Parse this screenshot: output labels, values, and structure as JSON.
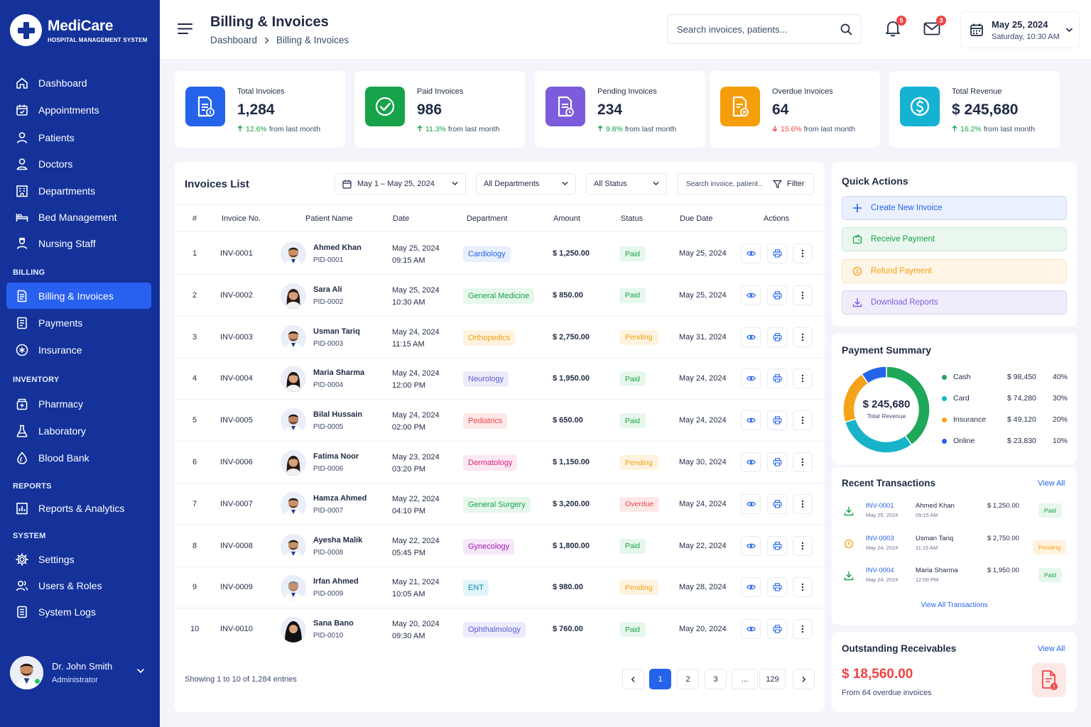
{
  "brand": {
    "name": "MediCare",
    "subtitle": "HOSPITAL MANAGEMENT SYSTEM"
  },
  "sidebar": {
    "main": [
      {
        "label": "Dashboard",
        "icon": "home-icon"
      },
      {
        "label": "Appointments",
        "icon": "calendar-icon"
      },
      {
        "label": "Patients",
        "icon": "user-icon"
      },
      {
        "label": "Doctors",
        "icon": "doctor-icon"
      },
      {
        "label": "Departments",
        "icon": "building-icon"
      },
      {
        "label": "Bed Management",
        "icon": "bed-icon"
      },
      {
        "label": "Nursing Staff",
        "icon": "nurse-icon"
      }
    ],
    "sections": {
      "billing": "BILLING",
      "inventory": "INVENTORY",
      "reports": "REPORTS",
      "system": "SYSTEM"
    },
    "billing": [
      {
        "label": "Billing & Invoices",
        "icon": "invoice-icon"
      },
      {
        "label": "Payments",
        "icon": "payments-icon"
      },
      {
        "label": "Insurance",
        "icon": "insurance-icon"
      }
    ],
    "inventory": [
      {
        "label": "Pharmacy",
        "icon": "pharmacy-icon"
      },
      {
        "label": "Laboratory",
        "icon": "flask-icon"
      },
      {
        "label": "Blood Bank",
        "icon": "blood-drop-icon"
      }
    ],
    "reports": [
      {
        "label": "Reports & Analytics",
        "icon": "analytics-icon"
      }
    ],
    "system": [
      {
        "label": "Settings",
        "icon": "gear-icon"
      },
      {
        "label": "Users & Roles",
        "icon": "users-icon"
      },
      {
        "label": "System Logs",
        "icon": "logs-icon"
      }
    ],
    "user": {
      "name": "Dr. John Smith",
      "role": "Administrator"
    }
  },
  "header": {
    "title": "Billing & Invoices",
    "breadcrumb": [
      "Dashboard",
      "Billing & Invoices"
    ],
    "search_placeholder": "Search invoices, patients...",
    "notifications_count": "5",
    "messages_count": "3",
    "date": "May 25, 2024",
    "day_time": "Saturday, 10:30 AM"
  },
  "stats": [
    {
      "label": "Total Invoices",
      "value": "1,284",
      "change": "12.6%",
      "direction": "up",
      "suffix": "from last month",
      "color": "#2563eb"
    },
    {
      "label": "Paid Invoices",
      "value": "986",
      "change": "11.3%",
      "direction": "up",
      "suffix": "from last month",
      "color": "#16a34a"
    },
    {
      "label": "Pending Invoices",
      "value": "234",
      "change": "9.8%",
      "direction": "up",
      "suffix": "from last month",
      "color": "#7c5cdb"
    },
    {
      "label": "Overdue Invoices",
      "value": "64",
      "change": "15.6%",
      "direction": "down",
      "suffix": "from last month",
      "color": "#f59e0b"
    },
    {
      "label": "Total Revenue",
      "value": "$ 245,680",
      "change": "16.2%",
      "direction": "up",
      "suffix": "from last month",
      "color": "#16b2d4"
    }
  ],
  "invoices": {
    "title": "Invoices List",
    "date_range": "May 1 – May 25, 2024",
    "department_filter": "All Departments",
    "status_filter": "All Status",
    "search_placeholder": "Search invoice, patient...",
    "filter_label": "Filter",
    "columns": [
      "#",
      "Invoice No.",
      "Patient Name",
      "Date",
      "Department",
      "Amount",
      "Status",
      "Due Date",
      "Actions"
    ],
    "rows": [
      {
        "n": "1",
        "inv": "INV-0001",
        "name": "Ahmed Khan",
        "pid": "PID-0001",
        "date": "May 25, 2024",
        "time": "09:15 AM",
        "dept": "Cardiology",
        "dept_color": "#2563eb",
        "dept_bg": "#e8effd",
        "amount": "$ 1,250.00",
        "status": "Paid",
        "due": "May 25, 2024",
        "gender": "m",
        "skin": "#c98e63",
        "hair": "#2a1b12"
      },
      {
        "n": "2",
        "inv": "INV-0002",
        "name": "Sara Ali",
        "pid": "PID-0002",
        "date": "May 25, 2024",
        "time": "10:30 AM",
        "dept": "General Medicine",
        "dept_color": "#15a34a",
        "dept_bg": "#e6f7ec",
        "amount": "$ 850.00",
        "status": "Paid",
        "due": "May 25, 2024",
        "gender": "f",
        "skin": "#d6a07a",
        "hair": "#2a1b12"
      },
      {
        "n": "3",
        "inv": "INV-0003",
        "name": "Usman Tariq",
        "pid": "PID-0003",
        "date": "May 24, 2024",
        "time": "11:15 AM",
        "dept": "Orthopedics",
        "dept_color": "#f59e0b",
        "dept_bg": "#fff3e0",
        "amount": "$ 2,750.00",
        "status": "Pending",
        "due": "May 31, 2024",
        "gender": "m",
        "skin": "#c8916b",
        "hair": "#1d1410"
      },
      {
        "n": "4",
        "inv": "INV-0004",
        "name": "Maria Sharma",
        "pid": "PID-0004",
        "date": "May 24, 2024",
        "time": "12:00 PM",
        "dept": "Neurology",
        "dept_color": "#5b5fd6",
        "dept_bg": "#ebebfb",
        "amount": "$ 1,950.00",
        "status": "Paid",
        "due": "May 24, 2024",
        "gender": "f",
        "skin": "#d9a57f",
        "hair": "#1d1410"
      },
      {
        "n": "5",
        "inv": "INV-0005",
        "name": "Bilal Hussain",
        "pid": "PID-0005",
        "date": "May 24, 2024",
        "time": "02:00 PM",
        "dept": "Pediatrics",
        "dept_color": "#ef4444",
        "dept_bg": "#fde8e8",
        "amount": "$ 650.00",
        "status": "Paid",
        "due": "May 24, 2024",
        "gender": "m",
        "skin": "#b98060",
        "hair": "#1d1410"
      },
      {
        "n": "6",
        "inv": "INV-0006",
        "name": "Fatima Noor",
        "pid": "PID-0006",
        "date": "May 23, 2024",
        "time": "03:20 PM",
        "dept": "Dermatology",
        "dept_color": "#db2777",
        "dept_bg": "#fce7f3",
        "amount": "$ 1,150.00",
        "status": "Pending",
        "due": "May 30, 2024",
        "gender": "f",
        "skin": "#d6a07a",
        "hair": "#2a1b12"
      },
      {
        "n": "7",
        "inv": "INV-0007",
        "name": "Hamza Ahmed",
        "pid": "PID-0007",
        "date": "May 22, 2024",
        "time": "04:10 PM",
        "dept": "General Surgery",
        "dept_color": "#15a34a",
        "dept_bg": "#e6f7ec",
        "amount": "$ 3,200.00",
        "status": "Overdue",
        "due": "May 24, 2024",
        "gender": "m",
        "skin": "#c8916b",
        "hair": "#1d1410"
      },
      {
        "n": "8",
        "inv": "INV-0008",
        "name": "Ayesha Malik",
        "pid": "PID-0008",
        "date": "May 22, 2024",
        "time": "05:45 PM",
        "dept": "Gynecology",
        "dept_color": "#a21caf",
        "dept_bg": "#f8e6fb",
        "amount": "$ 1,800.00",
        "status": "Paid",
        "due": "May 22, 2024",
        "gender": "m",
        "skin": "#c8916b",
        "hair": "#1d1410"
      },
      {
        "n": "9",
        "inv": "INV-0009",
        "name": "Irfan Ahmed",
        "pid": "PID-0009",
        "date": "May 21, 2024",
        "time": "10:05 AM",
        "dept": "ENT",
        "dept_color": "#0891b2",
        "dept_bg": "#e0f4f9",
        "amount": "$ 980.00",
        "status": "Pending",
        "due": "May 28, 2024",
        "gender": "m",
        "skin": "#c29272",
        "hair": "#8a8a8a"
      },
      {
        "n": "10",
        "inv": "INV-0010",
        "name": "Sana Bano",
        "pid": "PID-0010",
        "date": "May 20, 2024",
        "time": "09:30 AM",
        "dept": "Ophthalmology",
        "dept_color": "#5b5fd6",
        "dept_bg": "#ebebfb",
        "amount": "$ 760.00",
        "status": "Paid",
        "due": "May 20, 2024",
        "gender": "h",
        "skin": "#d9a57f",
        "hair": "#111111"
      }
    ],
    "showing": "Showing 1 to 10 of 1,284 entries",
    "pages": [
      "1",
      "2",
      "3",
      "...",
      "129"
    ],
    "current_page": "1"
  },
  "quick_actions": {
    "title": "Quick Actions",
    "items": [
      {
        "label": "Create New Invoice",
        "color": "#2563eb",
        "bg": "#eaf0fd",
        "border": "#c9d8fa",
        "icon": "plus-icon"
      },
      {
        "label": "Receive Payment",
        "color": "#16a34a",
        "bg": "#eaf7ee",
        "border": "#cbead6",
        "icon": "wallet-icon"
      },
      {
        "label": "Refund Payment",
        "color": "#f59e0b",
        "bg": "#fef5e7",
        "border": "#fbe3bf",
        "icon": "refund-icon"
      },
      {
        "label": "Download Reports",
        "color": "#7c5cdb",
        "bg": "#f0ecfb",
        "border": "#dcd3f5",
        "icon": "download-icon"
      }
    ]
  },
  "payment_summary": {
    "title": "Payment Summary",
    "total": "$ 245,680",
    "total_label": "Total Revenue"
  },
  "chart_data": {
    "type": "pie",
    "categories": [
      "Cash",
      "Card",
      "Insurance",
      "Online"
    ],
    "values": [
      98450,
      74280,
      49120,
      23830
    ],
    "amount_labels": [
      "$ 98,450",
      "$ 74,280",
      "$ 49,120",
      "$ 23,830"
    ],
    "percent_labels": [
      "40%",
      "30%",
      "20%",
      "10%"
    ],
    "colors": [
      "#1fa75a",
      "#19b3c9",
      "#f5a21b",
      "#2563eb"
    ]
  },
  "recent_transactions": {
    "title": "Recent Transactions",
    "view_all": "View All",
    "items": [
      {
        "inv": "INV-0001",
        "date": "May 25, 2024",
        "name": "Ahmed Khan",
        "time": "09:15 AM",
        "amount": "$ 1,250.00",
        "status": "Paid"
      },
      {
        "inv": "INV-0003",
        "date": "May 24, 2024",
        "name": "Usman Tariq",
        "time": "11:15 AM",
        "amount": "$ 2,750.00",
        "status": "Pending"
      },
      {
        "inv": "INV-0004",
        "date": "May 24, 2024",
        "name": "Maria Sharma",
        "time": "12:00 PM",
        "amount": "$ 1,950.00",
        "status": "Paid"
      }
    ],
    "view_all_transactions": "View All Transactions"
  },
  "receivables": {
    "title": "Outstanding Receivables",
    "view_all": "View All",
    "amount": "$ 18,560.00",
    "note": "From 64 overdue invoices"
  }
}
